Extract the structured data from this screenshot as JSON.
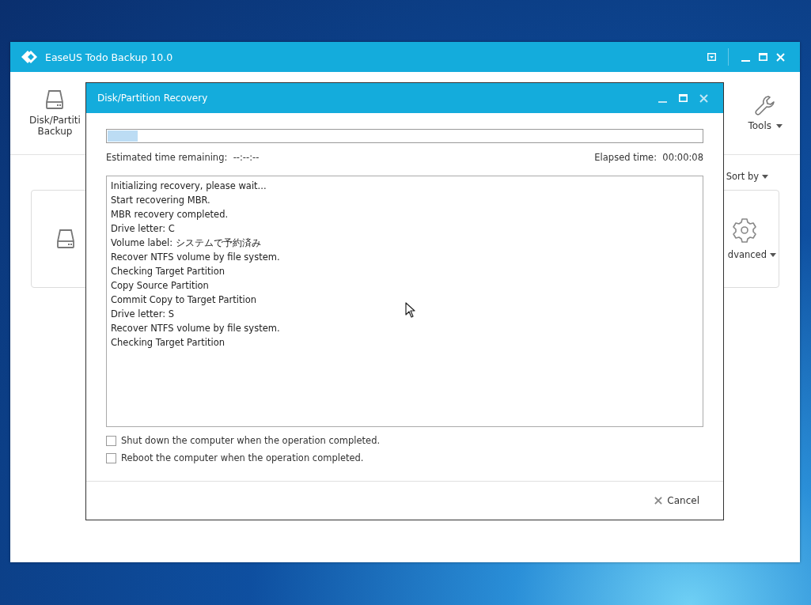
{
  "main_window": {
    "title": "EaseUS Todo Backup 10.0",
    "toolbar": [
      {
        "label_lines": [
          "Disk/Partiti",
          "Backup"
        ]
      },
      {
        "label": "Tools"
      }
    ],
    "sort_label": "Sort by",
    "advanced_label": "dvanced"
  },
  "dialog": {
    "title": "Disk/Partition Recovery",
    "progress": {
      "level": 0.05
    },
    "estimated_label": "Estimated time remaining:",
    "estimated_value": "--:--:--",
    "elapsed_label": "Elapsed time:",
    "elapsed_value": "00:00:08",
    "log": [
      "Initializing recovery, please wait...",
      "Start recovering MBR.",
      "MBR recovery completed.",
      "Drive letter: C",
      "Volume label: システムで予約済み",
      "Recover NTFS volume by file system.",
      "Checking Target Partition",
      "Copy Source Partition",
      "Commit Copy to Target Partition",
      "Drive letter: S",
      "Recover NTFS volume by file system.",
      "Checking Target Partition"
    ],
    "options": [
      {
        "label": "Shut down the computer when the operation completed.",
        "checked": false
      },
      {
        "label": "Reboot the computer when the operation completed.",
        "checked": false
      }
    ],
    "cancel_label": "Cancel"
  }
}
